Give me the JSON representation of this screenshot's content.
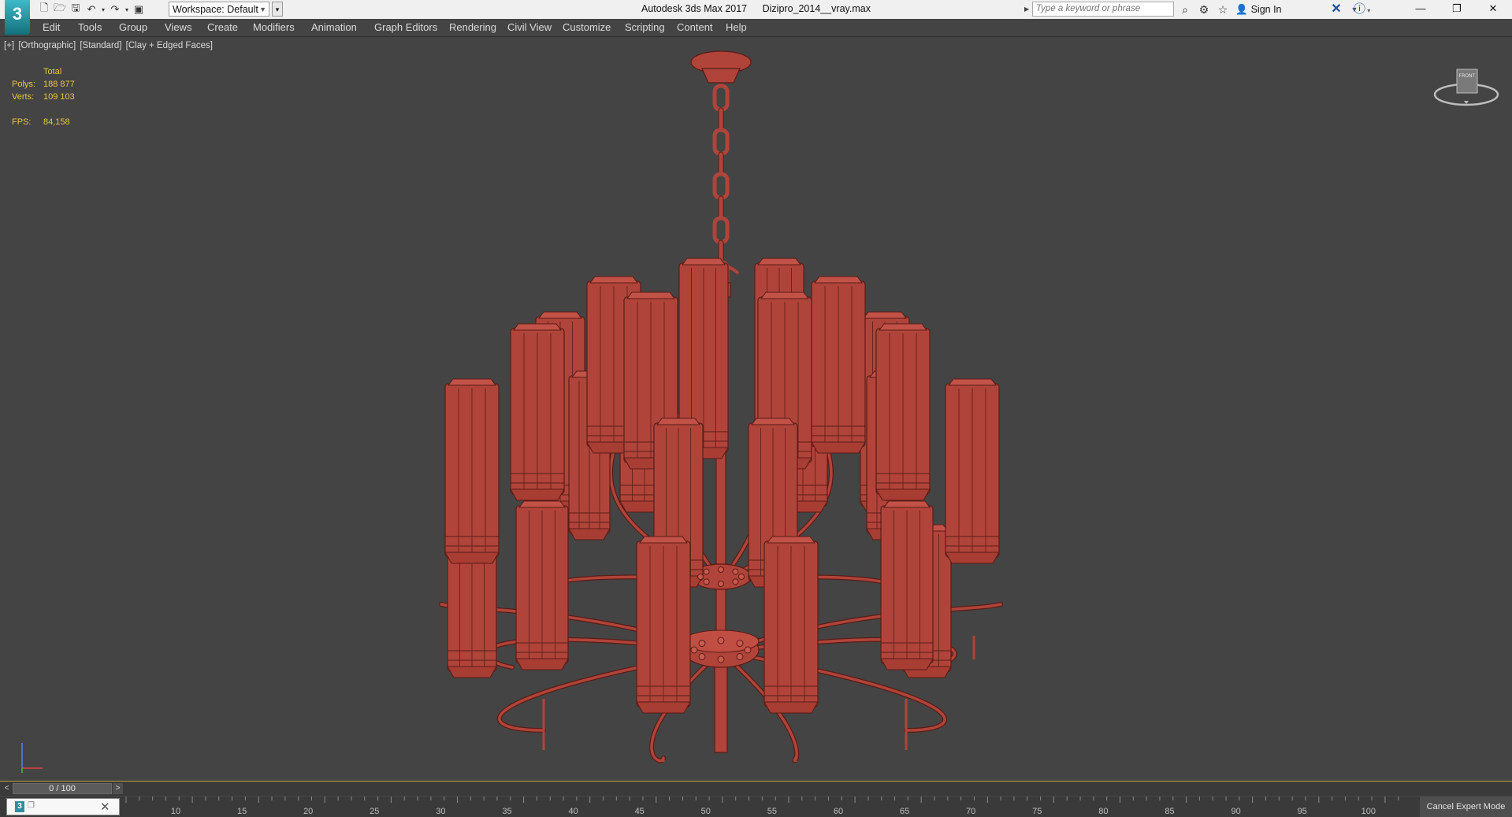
{
  "titlebar": {
    "app_name": "Autodesk 3ds Max 2017",
    "file_name": "Dizipro_2014__vray.max",
    "workspace_label": "Workspace: Default",
    "search_placeholder": "Type a keyword or phrase",
    "sign_in_label": "Sign In",
    "logo_glyph": "3"
  },
  "menu": {
    "items": [
      "Edit",
      "Tools",
      "Group",
      "Views",
      "Create",
      "Modifiers",
      "Animation",
      "Graph Editors",
      "Rendering",
      "Civil View",
      "Customize",
      "Scripting",
      "Content",
      "Help"
    ]
  },
  "viewport": {
    "label_parts": [
      "[+]",
      "[Orthographic]",
      "[Standard]",
      "[Clay + Edged Faces]"
    ],
    "stats": {
      "header": "Total",
      "polys_label": "Polys:",
      "polys_value": "188 877",
      "verts_label": "Verts:",
      "verts_value": "109 103",
      "fps_label": "FPS:",
      "fps_value": "84,158"
    },
    "model_color": "#b0443a",
    "edge_color": "#5a1c16",
    "viewcube_label": "FRONT"
  },
  "timeline": {
    "frame_label": "0 / 100",
    "ticks": [
      "10",
      "15",
      "20",
      "25",
      "30",
      "35",
      "40",
      "45",
      "50",
      "55",
      "60",
      "65",
      "70",
      "75",
      "80",
      "85",
      "90",
      "95",
      "100"
    ],
    "expert_label": "Cancel Expert Mode"
  },
  "colors": {
    "viewport_bg": "#444444",
    "stats_text": "#e6c545",
    "accent_teal": "#2f8fa0"
  }
}
